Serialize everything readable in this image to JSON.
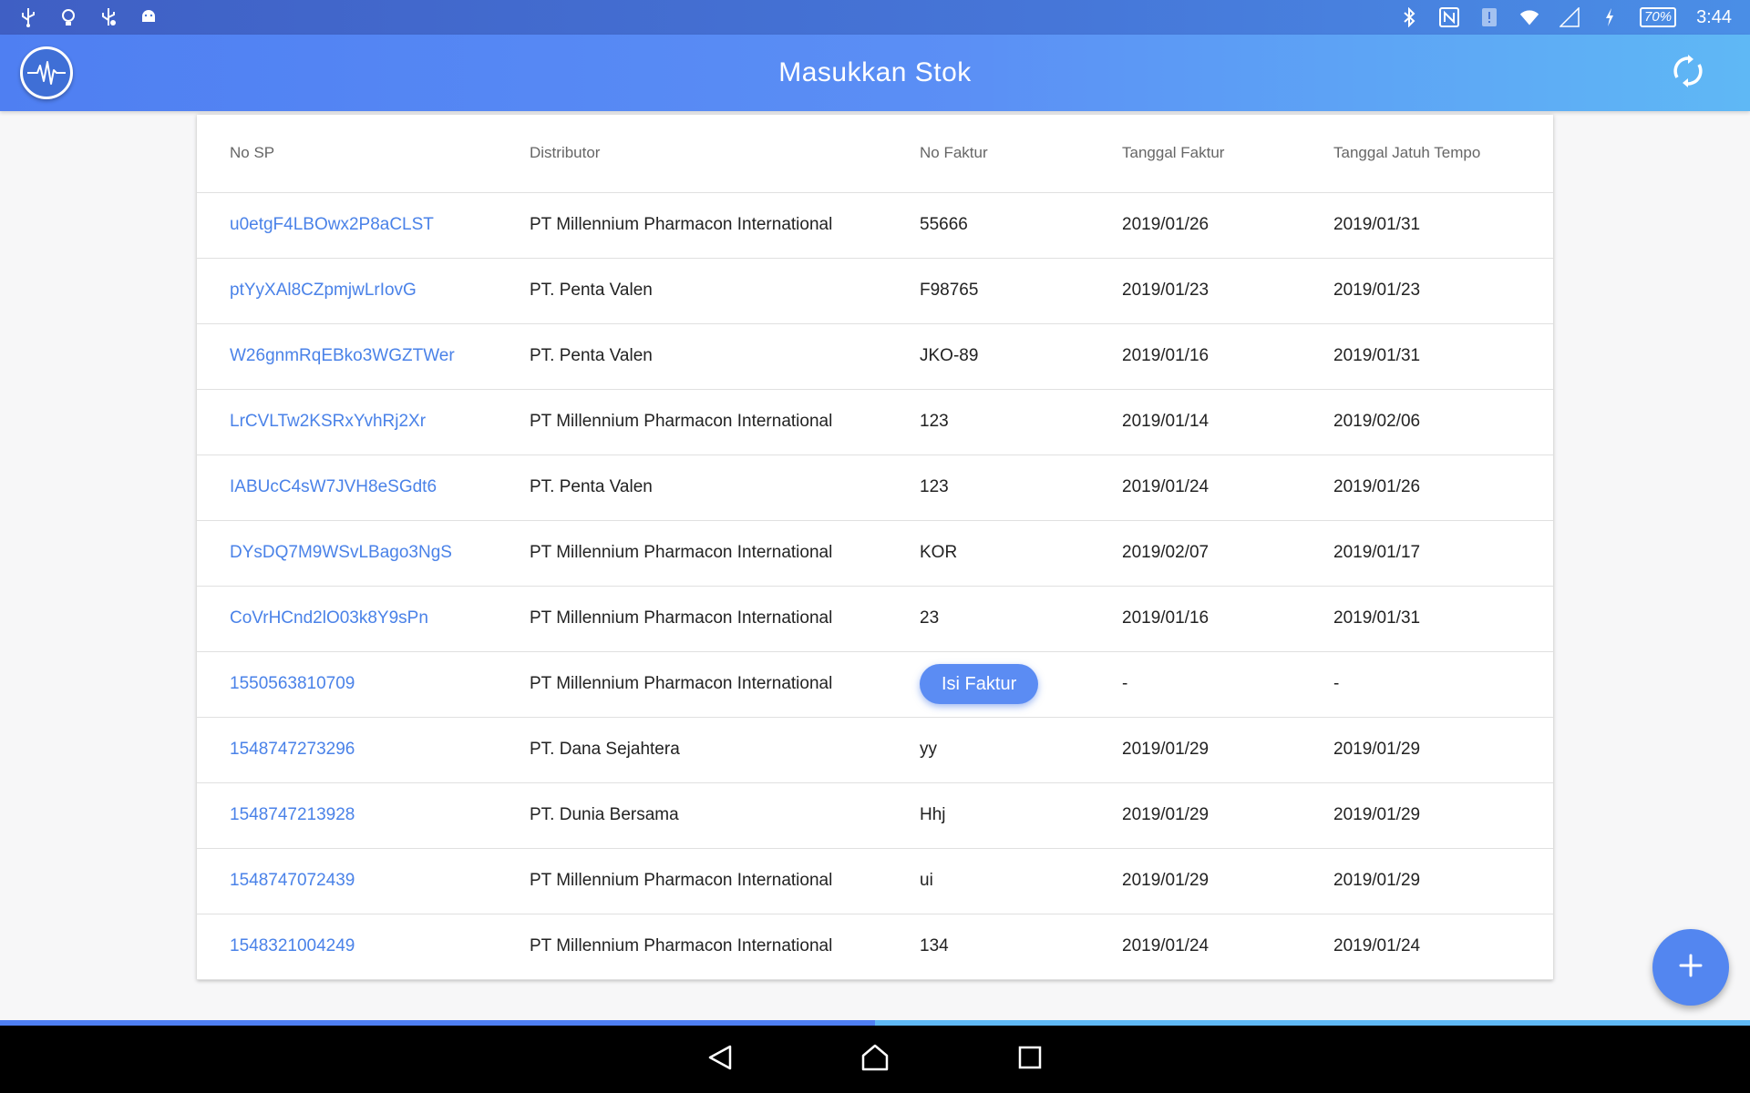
{
  "status_bar": {
    "left_icons": [
      "usb-icon",
      "bulb-icon",
      "usb-debug-icon",
      "android-icon"
    ],
    "right_icons": [
      "bluetooth-icon",
      "nfc-icon",
      "alert-icon",
      "wifi-icon",
      "signal-icon",
      "charging-icon"
    ],
    "battery": "70%",
    "time": "3:44"
  },
  "app_bar": {
    "title": "Masukkan Stok",
    "logo_icon": "pulse-logo-icon",
    "refresh_icon": "refresh-icon"
  },
  "table": {
    "headers": [
      "No SP",
      "Distributor",
      "No Faktur",
      "Tanggal Faktur",
      "Tanggal Jatuh Tempo"
    ],
    "rows": [
      {
        "no_sp": "u0etgF4LBOwx2P8aCLST",
        "distributor": "PT Millennium Pharmacon International",
        "no_faktur": "55666",
        "tanggal_faktur": "2019/01/26",
        "jatuh_tempo": "2019/01/31"
      },
      {
        "no_sp": "ptYyXAl8CZpmjwLrIovG",
        "distributor": "PT. Penta Valen",
        "no_faktur": "F98765",
        "tanggal_faktur": "2019/01/23",
        "jatuh_tempo": "2019/01/23"
      },
      {
        "no_sp": "W26gnmRqEBko3WGZTWer",
        "distributor": "PT. Penta Valen",
        "no_faktur": "JKO-89",
        "tanggal_faktur": "2019/01/16",
        "jatuh_tempo": "2019/01/31"
      },
      {
        "no_sp": "LrCVLTw2KSRxYvhRj2Xr",
        "distributor": "PT Millennium Pharmacon International",
        "no_faktur": "123",
        "tanggal_faktur": "2019/01/14",
        "jatuh_tempo": "2019/02/06"
      },
      {
        "no_sp": "IABUcC4sW7JVH8eSGdt6",
        "distributor": "PT. Penta Valen",
        "no_faktur": "123",
        "tanggal_faktur": "2019/01/24",
        "jatuh_tempo": "2019/01/26"
      },
      {
        "no_sp": "DYsDQ7M9WSvLBago3NgS",
        "distributor": "PT Millennium Pharmacon International",
        "no_faktur": "KOR",
        "tanggal_faktur": "2019/02/07",
        "jatuh_tempo": "2019/01/17"
      },
      {
        "no_sp": "CoVrHCnd2lO03k8Y9sPn",
        "distributor": "PT Millennium Pharmacon International",
        "no_faktur": "23",
        "tanggal_faktur": "2019/01/16",
        "jatuh_tempo": "2019/01/31"
      },
      {
        "no_sp": "1550563810709",
        "distributor": "PT Millennium Pharmacon International",
        "no_faktur": "",
        "button": "Isi Faktur",
        "tanggal_faktur": "-",
        "jatuh_tempo": "-"
      },
      {
        "no_sp": "1548747273296",
        "distributor": "PT. Dana Sejahtera",
        "no_faktur": "yy",
        "tanggal_faktur": "2019/01/29",
        "jatuh_tempo": "2019/01/29"
      },
      {
        "no_sp": "1548747213928",
        "distributor": "PT. Dunia Bersama",
        "no_faktur": "Hhj",
        "tanggal_faktur": "2019/01/29",
        "jatuh_tempo": "2019/01/29"
      },
      {
        "no_sp": "1548747072439",
        "distributor": "PT Millennium Pharmacon International",
        "no_faktur": "ui",
        "tanggal_faktur": "2019/01/29",
        "jatuh_tempo": "2019/01/29"
      },
      {
        "no_sp": "1548321004249",
        "distributor": "PT Millennium Pharmacon International",
        "no_faktur": "134",
        "tanggal_faktur": "2019/01/24",
        "jatuh_tempo": "2019/01/24"
      }
    ]
  },
  "fab": {
    "icon": "plus-icon"
  },
  "nav_bar": {
    "icons": [
      "back-icon",
      "home-icon",
      "recents-icon"
    ]
  },
  "colors": {
    "accent": "#5386f0",
    "link": "#4a82e8",
    "appbar_start": "#4f7ff2",
    "appbar_end": "#5fb8f5"
  }
}
